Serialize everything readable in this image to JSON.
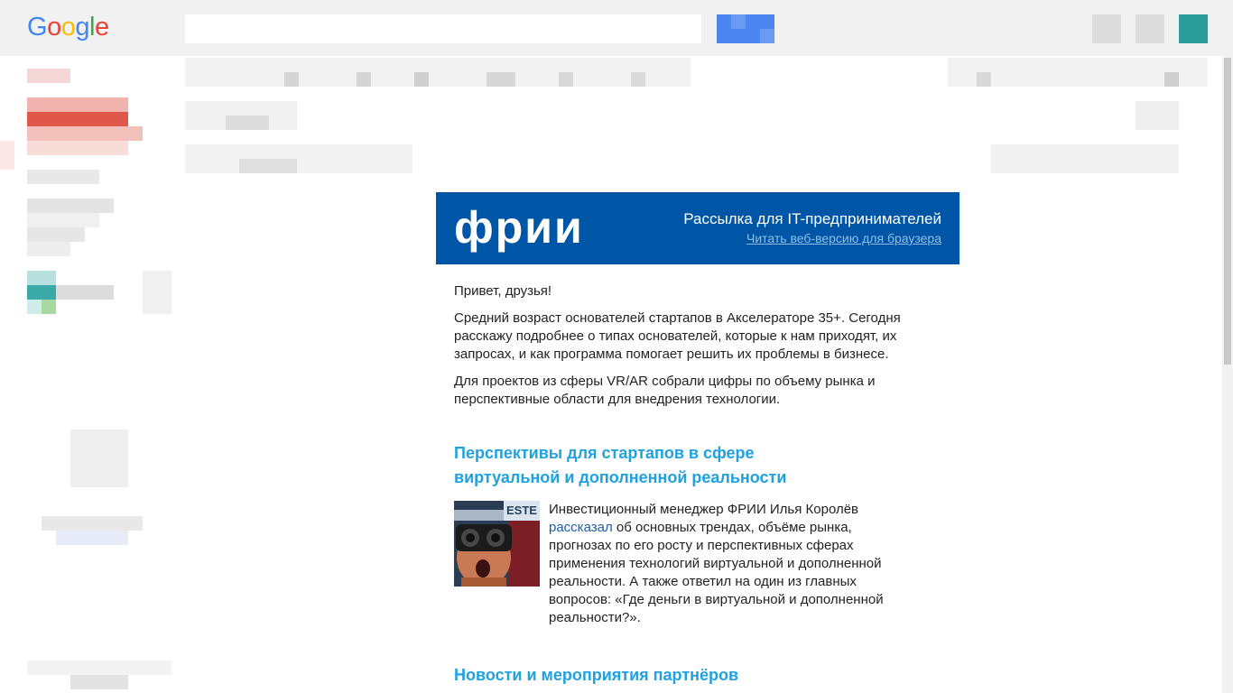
{
  "header": {
    "logo": [
      {
        "ch": "G",
        "color": "#4285F4"
      },
      {
        "ch": "o",
        "color": "#EA4335"
      },
      {
        "ch": "o",
        "color": "#FBBC05"
      },
      {
        "ch": "g",
        "color": "#4285F4"
      },
      {
        "ch": "l",
        "color": "#34A853"
      },
      {
        "ch": "e",
        "color": "#EA4335"
      }
    ]
  },
  "email": {
    "brand": "фрии",
    "header_title": "Рассылка для IT-предпринимателей",
    "web_version_link": "Читать веб-версию для браузера",
    "greeting": "Привет, друзья!",
    "paragraph1": "Средний возраст основателей стартапов в Акселераторе 35+. Сегодня расскажу подробнее о типах основателей, которые к нам приходят, их запросах, и как программа помогает решить их проблемы в бизнесе.",
    "paragraph2": "Для проектов из сферы VR/AR собрали цифры по объему рынка и перспективные области для внедрения технологии.",
    "section1_title": "Перспективы для стартапов в сфере виртуальной и дополненной реальности",
    "article1_intro": "Инвестиционный менеджер ФРИИ Илья Королёв",
    "article1_link": "рассказал",
    "article1_rest": " об основных трендах, объёме рынка, прогнозах по его росту и перспективных сферах применения технологий виртуальной и дополненной реальности. А также ответил на один из главных вопросов: «Где деньги в виртуальной и дополненной реальности?».",
    "section2_title": "Новости и мероприятия партнёров"
  },
  "colors": {
    "brand_blue": "#0056a6",
    "heading_blue": "#1fa2df",
    "link_blue": "#1d5fa6"
  }
}
